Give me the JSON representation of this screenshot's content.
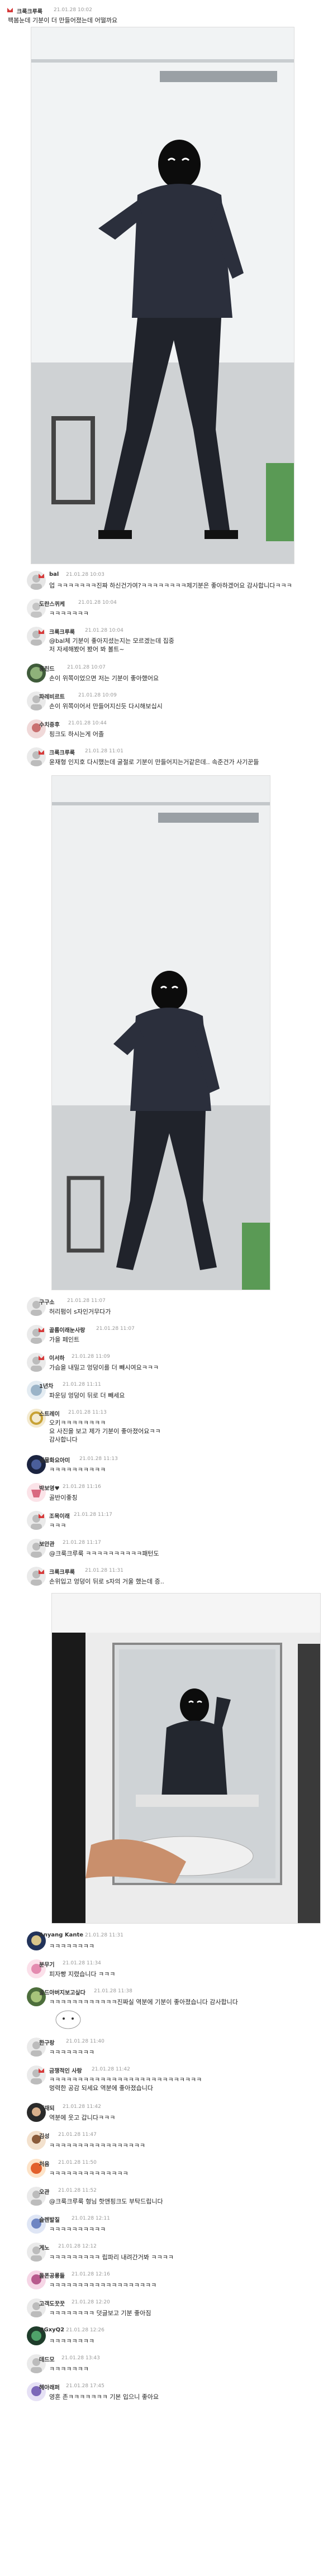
{
  "post": {
    "username": "크룩크루룩",
    "date": "21.01.28 10:02",
    "text": "팩봄눈데 기분이 더 만들어졌는데 어떨까요"
  },
  "comments": [
    {
      "user": "bal",
      "date": "21.01.28 10:03",
      "text": "업 ㅋㅋㅋㅋㅋㅋㅋ진짜 하신건가여?ㅋㅋㅋㅋㅋㅋㅋㅋ제기분은 좋아하겠어요 감사합니다ㅋㅋㅋ"
    },
    {
      "user": "도란스퀴케",
      "date": "21.01.28 10:04",
      "text": "ㅋㅋㅋㅋㅋㅋㅋ"
    },
    {
      "user": "크룩크루룩",
      "date": "21.01.28 10:04",
      "text": "@bal체 기분이 좋아지셨는지는 모르겠는데 집중\n저 자세해봤어 봤어 봐 볼트~"
    },
    {
      "user": "홍린드",
      "date": "21.01.28 10:07",
      "text": "손이 위쪽이었으면 저는 기분이 좋아했어요"
    },
    {
      "user": "파레비르트",
      "date": "21.01.28 10:09",
      "text": "손이 위쪽이어서 만들어지신듯 다시해보십시"
    },
    {
      "user": "수치중후",
      "date": "21.01.28 10:44",
      "text": "핑크도 하시는게 어졸"
    },
    {
      "user": "크룩크루룩",
      "date": "21.01.28 11:01",
      "text": "윤재형 인지호 다시했는데 굴절로 기분이 만들어지는거같은데.. 속준건가 사기꾼들"
    },
    {
      "user": "구구소",
      "date": "21.01.28 11:07",
      "text": "허리펌이 s자인거무다가"
    },
    {
      "user": "골롬이래눈사랑",
      "date": "21.01.28 11:07",
      "text": "가을 페인트"
    },
    {
      "user": "이서하",
      "date": "21.01.28 11:09",
      "text": "가슴을 내밀고 엉덩이를 더 빼시여요ㅋㅋㅋ"
    },
    {
      "user": "1년차",
      "date": "21.01.28 11:11",
      "text": "파운딩 엉덩이 뒤로 더 빼세요"
    },
    {
      "user": "스트레이",
      "date": "21.01.28 11:13",
      "text": "오키ㅋㅋㅋㅋㅋㅋㅋㅋ\n요 사진을 보고 제가 기분이 좋아졌어요ㅋㅋ\n감사합니다"
    },
    {
      "user": "생물화요아미",
      "date": "21.01.28 11:13",
      "text": "ㅋㅋㅋㅋㅋㅋㅋㅋㅋㅋ"
    },
    {
      "user": "박보영♥",
      "date": "21.01.28 11:16",
      "text": "골반이좋칭"
    },
    {
      "user": "조목이래",
      "date": "21.01.28 11:17",
      "text": "ㅋㅋㅋ"
    },
    {
      "user": "보안관",
      "date": "21.01.28 11:17",
      "text": "@크룩크루룩 ㅋㅋㅋㅋㅋㅋㅋㅋㅋㅋ패턴도"
    },
    {
      "user": "크룩크루룩",
      "date": "21.01.28 11:31",
      "text": "손위입고 엉덩이 뒤로 s자의 거울 했는데 증.."
    },
    {
      "user": "Anyang Kante",
      "date": "21.01.28 11:31",
      "text": "ㅋㅋㅋㅋㅋㅋㅋㅋ"
    },
    {
      "user": "분무기",
      "date": "21.01.28 11:34",
      "text": "피자빵 지렸습니다 ㅋㅋㅋ"
    },
    {
      "user": "골드아버지보고싶다",
      "date": "21.01.28 11:38",
      "text": "ㅋㅋㅋㅋㅋㅋㅋㅋㅋㅋㅋㅋ진짜실 역분에 기분이 좋아졌습니다 감사합니다"
    },
    {
      "user": "한구랑",
      "date": "21.01.28 11:40",
      "text": "ㅋㅋㅋㅋㅋㅋㅋㅋ"
    },
    {
      "user": "금쟁적인 사랑",
      "date": "21.01.28 11:42",
      "text": "ㅋㅋㅋㅋㅋㅋㅋㅋㅋㅋㅋㅋㅋㅋㅋㅋㅋㅋㅋㅋㅋㅋㅋㅋㅋㅋㅋ\n멍력한 공감 되세요 역분에 좋아졌습니다"
    },
    {
      "user": "철재되",
      "date": "21.01.28 11:42",
      "text": "역분에 웃고 갑니다ㅋㅋㅋ"
    },
    {
      "user": "김성",
      "date": "21.01.28 11:47",
      "text": "ㅋㅋㅋㅋㅋㅋㅋㅋㅋㅋㅋㅋㅋㅋㅋㅋㅋ"
    },
    {
      "user": "처음",
      "date": "21.01.28 11:50",
      "text": "ㅋㅋㅋㅋㅋㅋㅋㅋㅋㅋㅋㅋㅋㅋ"
    },
    {
      "user": "오관",
      "date": "21.01.28 11:52",
      "text": "@크룩크루룩 형님 핫앤핑크도 부탁드립니다"
    },
    {
      "user": "슬렌발질",
      "date": "21.01.28 12:11",
      "text": "ㅋㅋㅋㅋㅋㅋㅋㅋㅋㅋ"
    },
    {
      "user": "게노",
      "date": "21.01.28 12:12",
      "text": "ㅋㅋㅋㅋㅋㅋㅋㅋㅋ 립파리 내려간거봐 ㅋㅋㅋㅋ"
    },
    {
      "user": "돌폰공룡들",
      "date": "21.01.28 12:16",
      "text": "ㅋㅋㅋㅋㅋㅋㅋㅋㅋㅋㅋㅋㅋㅋㅋㅋㅋㅋㅋ"
    },
    {
      "user": "고객도꿋꿋",
      "date": "21.01.28 12:20",
      "text": "ㅋㅋㅋㅋㅋㅋㅋㅋ 덧글보고 기분 좋아짐"
    },
    {
      "user": "QGxyQ2",
      "date": "21.01.28 12:26",
      "text": "ㅋㅋㅋㅋㅋㅋㅋㅋ"
    },
    {
      "user": "데드모",
      "date": "21.01.28 13:43",
      "text": "ㅋㅋㅋㅋㅋㅋㅋ"
    },
    {
      "user": "헤아래퍼",
      "date": "21.01.28 17:45",
      "text": "영혼 존ㅋㅋㅋㅋㅋㅋㅋ 기본 입으니 좋아요"
    }
  ],
  "colors": {
    "icon_red": "#d63a3a",
    "text": "#222222",
    "date": "#9a9a9a"
  }
}
